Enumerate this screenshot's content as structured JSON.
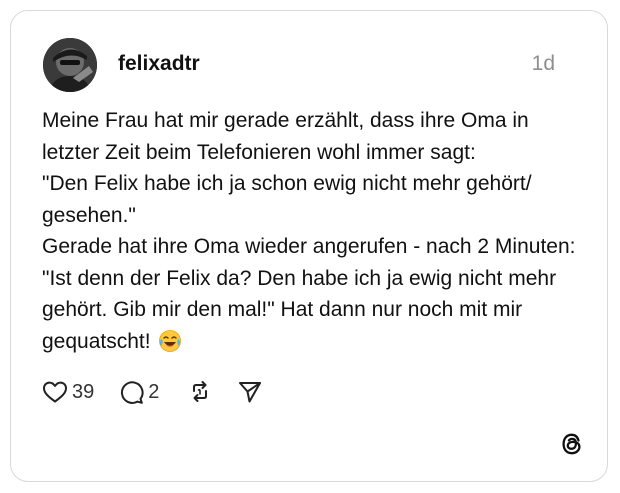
{
  "post": {
    "username": "felixadtr",
    "timestamp": "1d",
    "text": "Meine Frau hat mir gerade erzählt, dass ihre Oma in letzter Zeit beim Telefonieren wohl immer sagt:\n\"Den Felix habe ich ja schon ewig nicht mehr gehört/ gesehen.\"\nGerade hat ihre Oma wieder angerufen - nach 2 Minuten: \"Ist denn der Felix da? Den habe ich ja ewig nicht mehr gehört. Gib mir den mal!\" Hat dann nur noch mit mir gequatscht!",
    "emoji_icon": "tears-of-joy-emoji"
  },
  "actions": {
    "like_icon": "heart-icon",
    "like_count": "39",
    "comment_icon": "comment-icon",
    "comment_count": "2",
    "repost_icon": "repost-icon",
    "share_icon": "share-icon"
  },
  "branding": {
    "logo": "threads-logo-icon"
  },
  "colors": {
    "text": "#111111",
    "muted": "#8e8e8e",
    "border": "#d9d9d9",
    "background": "#ffffff"
  }
}
